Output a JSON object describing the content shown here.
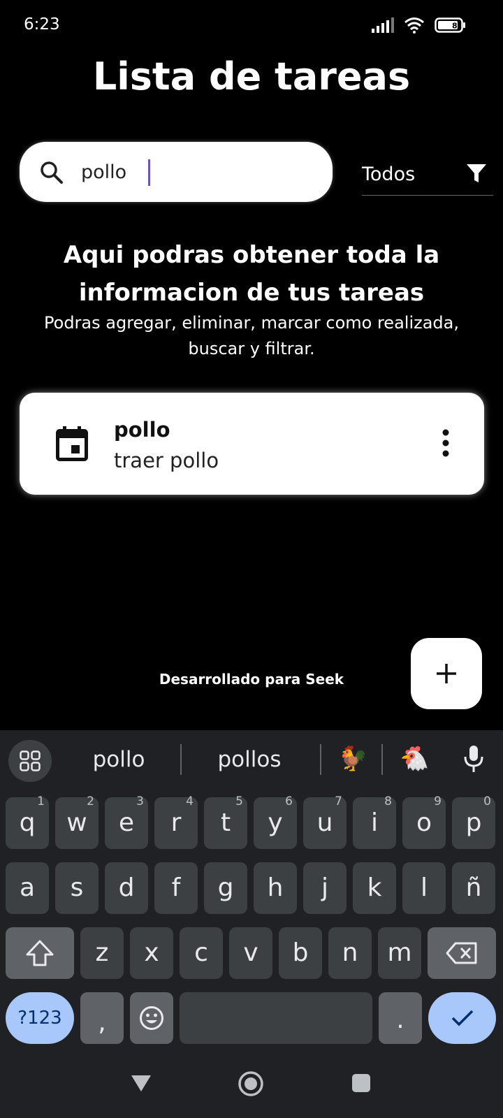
{
  "status_bar": {
    "time": "6:23",
    "battery_level": "8"
  },
  "app": {
    "title": "Lista de tareas"
  },
  "search": {
    "value": "pollo",
    "placeholder": ""
  },
  "filter": {
    "selected": "Todos"
  },
  "intro": {
    "heading": "Aqui podras obtener toda la informacion de tus tareas",
    "subtext": "Podras agregar, eliminar, marcar como realizada, buscar y filtrar."
  },
  "tasks": [
    {
      "title": "pollo",
      "description": "traer pollo"
    }
  ],
  "footer": {
    "credit": "Desarrollado para Seek"
  },
  "keyboard": {
    "suggestions": [
      "pollo",
      "pollos"
    ],
    "emoji_suggestions": [
      "🐓",
      "🐔"
    ],
    "row1": [
      "q",
      "w",
      "e",
      "r",
      "t",
      "y",
      "u",
      "i",
      "o",
      "p"
    ],
    "row1_hints": [
      "1",
      "2",
      "3",
      "4",
      "5",
      "6",
      "7",
      "8",
      "9",
      "0"
    ],
    "row2": [
      "a",
      "s",
      "d",
      "f",
      "g",
      "h",
      "j",
      "k",
      "l",
      "ñ"
    ],
    "row3": [
      "z",
      "x",
      "c",
      "v",
      "b",
      "n",
      "m"
    ],
    "symbols_label": "?123",
    "comma": ",",
    "period": "."
  },
  "colors": {
    "background": "#000000",
    "card": "#ffffff",
    "keyboard_bg": "#202124",
    "key_bg": "#3c4043",
    "accent_key": "#a8c7fa",
    "caret": "#6d52c4"
  }
}
